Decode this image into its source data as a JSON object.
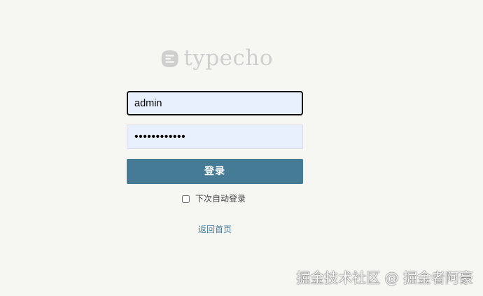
{
  "brand": {
    "logo_text": "typecho",
    "logo_color": "#cfcfcf"
  },
  "login_form": {
    "username_value": "admin",
    "password_value": "••••••••••••",
    "login_button_label": "登录",
    "remember_me_label": "下次自动登录",
    "remember_me_checked": false
  },
  "footer": {
    "back_home_link": "返回首页"
  },
  "watermark": {
    "text": "掘金技术社区 @ 掘金者阿豪"
  },
  "colors": {
    "background": "#f6f6f3",
    "accent": "#467b96",
    "input_fill": "#e8f0fe"
  }
}
